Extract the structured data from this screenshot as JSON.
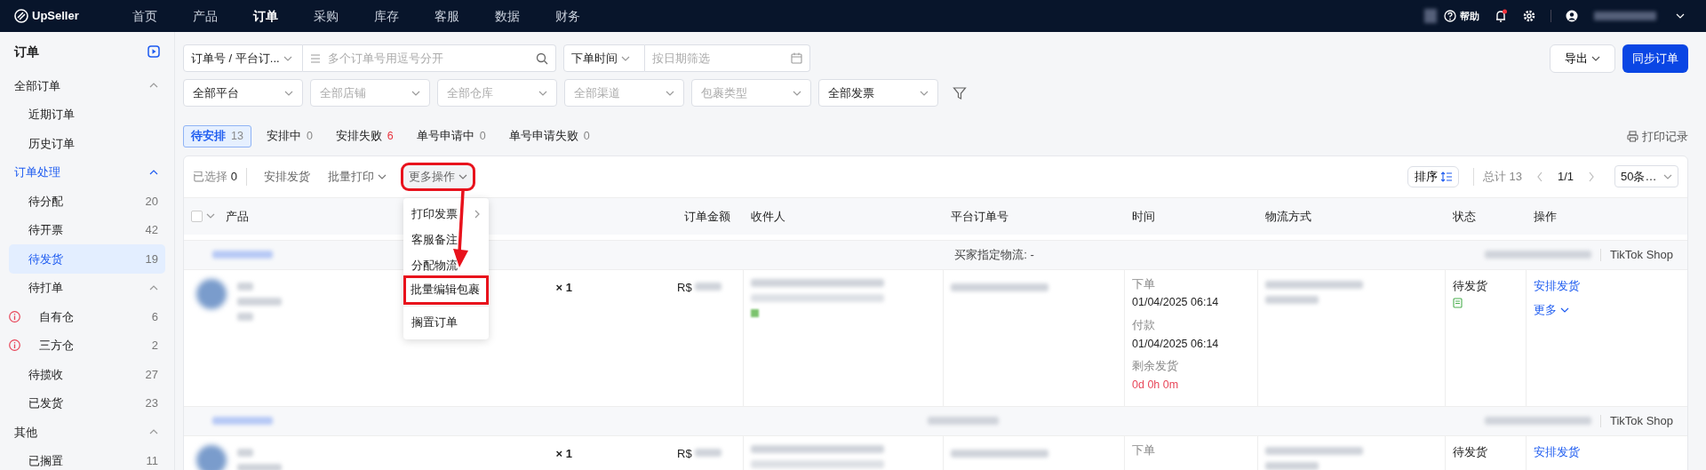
{
  "topbar": {
    "logo": "UpSeller",
    "nav": [
      {
        "label": "首页",
        "selected": false
      },
      {
        "label": "产品",
        "selected": false
      },
      {
        "label": "订单",
        "selected": true
      },
      {
        "label": "采购",
        "selected": false
      },
      {
        "label": "库存",
        "selected": false
      },
      {
        "label": "客服",
        "selected": false
      },
      {
        "label": "数据",
        "selected": false
      },
      {
        "label": "财务",
        "selected": false
      }
    ],
    "help": "帮助",
    "notification_dot": true
  },
  "sidebar": {
    "title": "订单",
    "groups": [
      {
        "label": "全部订单",
        "selected": false,
        "expanded": true,
        "children": [
          {
            "label": "近期订单",
            "selected": false
          },
          {
            "label": "历史订单",
            "selected": false
          }
        ]
      },
      {
        "label": "订单处理",
        "selected": true,
        "expanded": true,
        "children": [
          {
            "label": "待分配",
            "count": "20",
            "selected": false
          },
          {
            "label": "待开票",
            "count": "42",
            "selected": false
          },
          {
            "label": "待发货",
            "count": "19",
            "selected": true
          },
          {
            "label": "待打单",
            "selected": false,
            "expanded": true,
            "children": [
              {
                "label": "自有仓",
                "count": "6",
                "warning": true,
                "selected": false
              },
              {
                "label": "三方仓",
                "count": "2",
                "warning": true,
                "selected": false
              }
            ]
          },
          {
            "label": "待揽收",
            "count": "27",
            "selected": false
          },
          {
            "label": "已发货",
            "count": "23",
            "selected": false
          }
        ]
      },
      {
        "label": "其他",
        "selected": false,
        "expanded": true,
        "children": [
          {
            "label": "已搁置",
            "count": "11",
            "selected": false
          }
        ]
      }
    ]
  },
  "filters": {
    "search_type": "订单号 / 平台订...",
    "search": {
      "placeholder": "多个订单号用逗号分开"
    },
    "date_type": "下单时间",
    "date": {
      "placeholder": "按日期筛选"
    },
    "selects": [
      {
        "value": "全部平台"
      },
      {
        "placeholder": "全部店铺"
      },
      {
        "placeholder": "全部仓库"
      },
      {
        "placeholder": "全部渠道"
      },
      {
        "placeholder": "包裹类型"
      },
      {
        "value": "全部发票"
      }
    ]
  },
  "header_buttons": {
    "export": "导出",
    "sync": "同步订单"
  },
  "status_tabs": [
    {
      "label": "待安排",
      "count": "13",
      "selected": true,
      "alert": false
    },
    {
      "label": "安排中",
      "count": "0",
      "selected": false,
      "alert": false
    },
    {
      "label": "安排失败",
      "count": "6",
      "selected": false,
      "alert": true
    },
    {
      "label": "单号申请中",
      "count": "0",
      "selected": false,
      "alert": false
    },
    {
      "label": "单号申请失败",
      "count": "0",
      "selected": false,
      "alert": false
    }
  ],
  "print_log": "打印记录",
  "toolbar": {
    "selected_label": "已选择",
    "selected_count": "0",
    "actions": [
      {
        "label": "安排发货",
        "dropdown": false,
        "highlighted": false
      },
      {
        "label": "批量打印",
        "dropdown": true,
        "highlighted": false
      },
      {
        "label": "更多操作",
        "dropdown": true,
        "highlighted": true
      }
    ],
    "sort": "排序",
    "total": "总计 13",
    "page": "1/1",
    "page_size": "50条…"
  },
  "more_menu": [
    {
      "label": "打印发票",
      "submenu": true,
      "highlighted": false,
      "divider_before": false
    },
    {
      "label": "客服备注",
      "submenu": false,
      "highlighted": false,
      "divider_before": false
    },
    {
      "label": "分配物流",
      "submenu": false,
      "highlighted": false,
      "divider_before": false
    },
    {
      "label": "批量编辑包裹",
      "submenu": false,
      "highlighted": true,
      "divider_before": false
    },
    {
      "label": "搁置订单",
      "submenu": false,
      "highlighted": false,
      "divider_before": true
    }
  ],
  "table": {
    "select_all": {
      "checked": false
    },
    "columns": [
      "产品",
      "订单金额",
      "收件人",
      "平台订单号",
      "时间",
      "物流方式",
      "状态",
      "操作"
    ],
    "orders": [
      {
        "group_note": "买家指定物流: -",
        "platform": "TikTok Shop",
        "quantity": "× 1",
        "currency": "R$",
        "times": [
          {
            "label": "下单",
            "value": "01/04/2025 06:14"
          },
          {
            "label": "付款",
            "value": "01/04/2025 06:14"
          }
        ],
        "remaining": {
          "label": "剩余发货",
          "value": "0d 0h 0m"
        },
        "status": "待发货",
        "action": "安排发货",
        "more": "更多"
      },
      {
        "platform": "TikTok Shop",
        "quantity": "× 1",
        "currency": "R$",
        "times": [
          {
            "label": "下单"
          }
        ],
        "status": "待发货",
        "action": "安排发货"
      }
    ]
  }
}
